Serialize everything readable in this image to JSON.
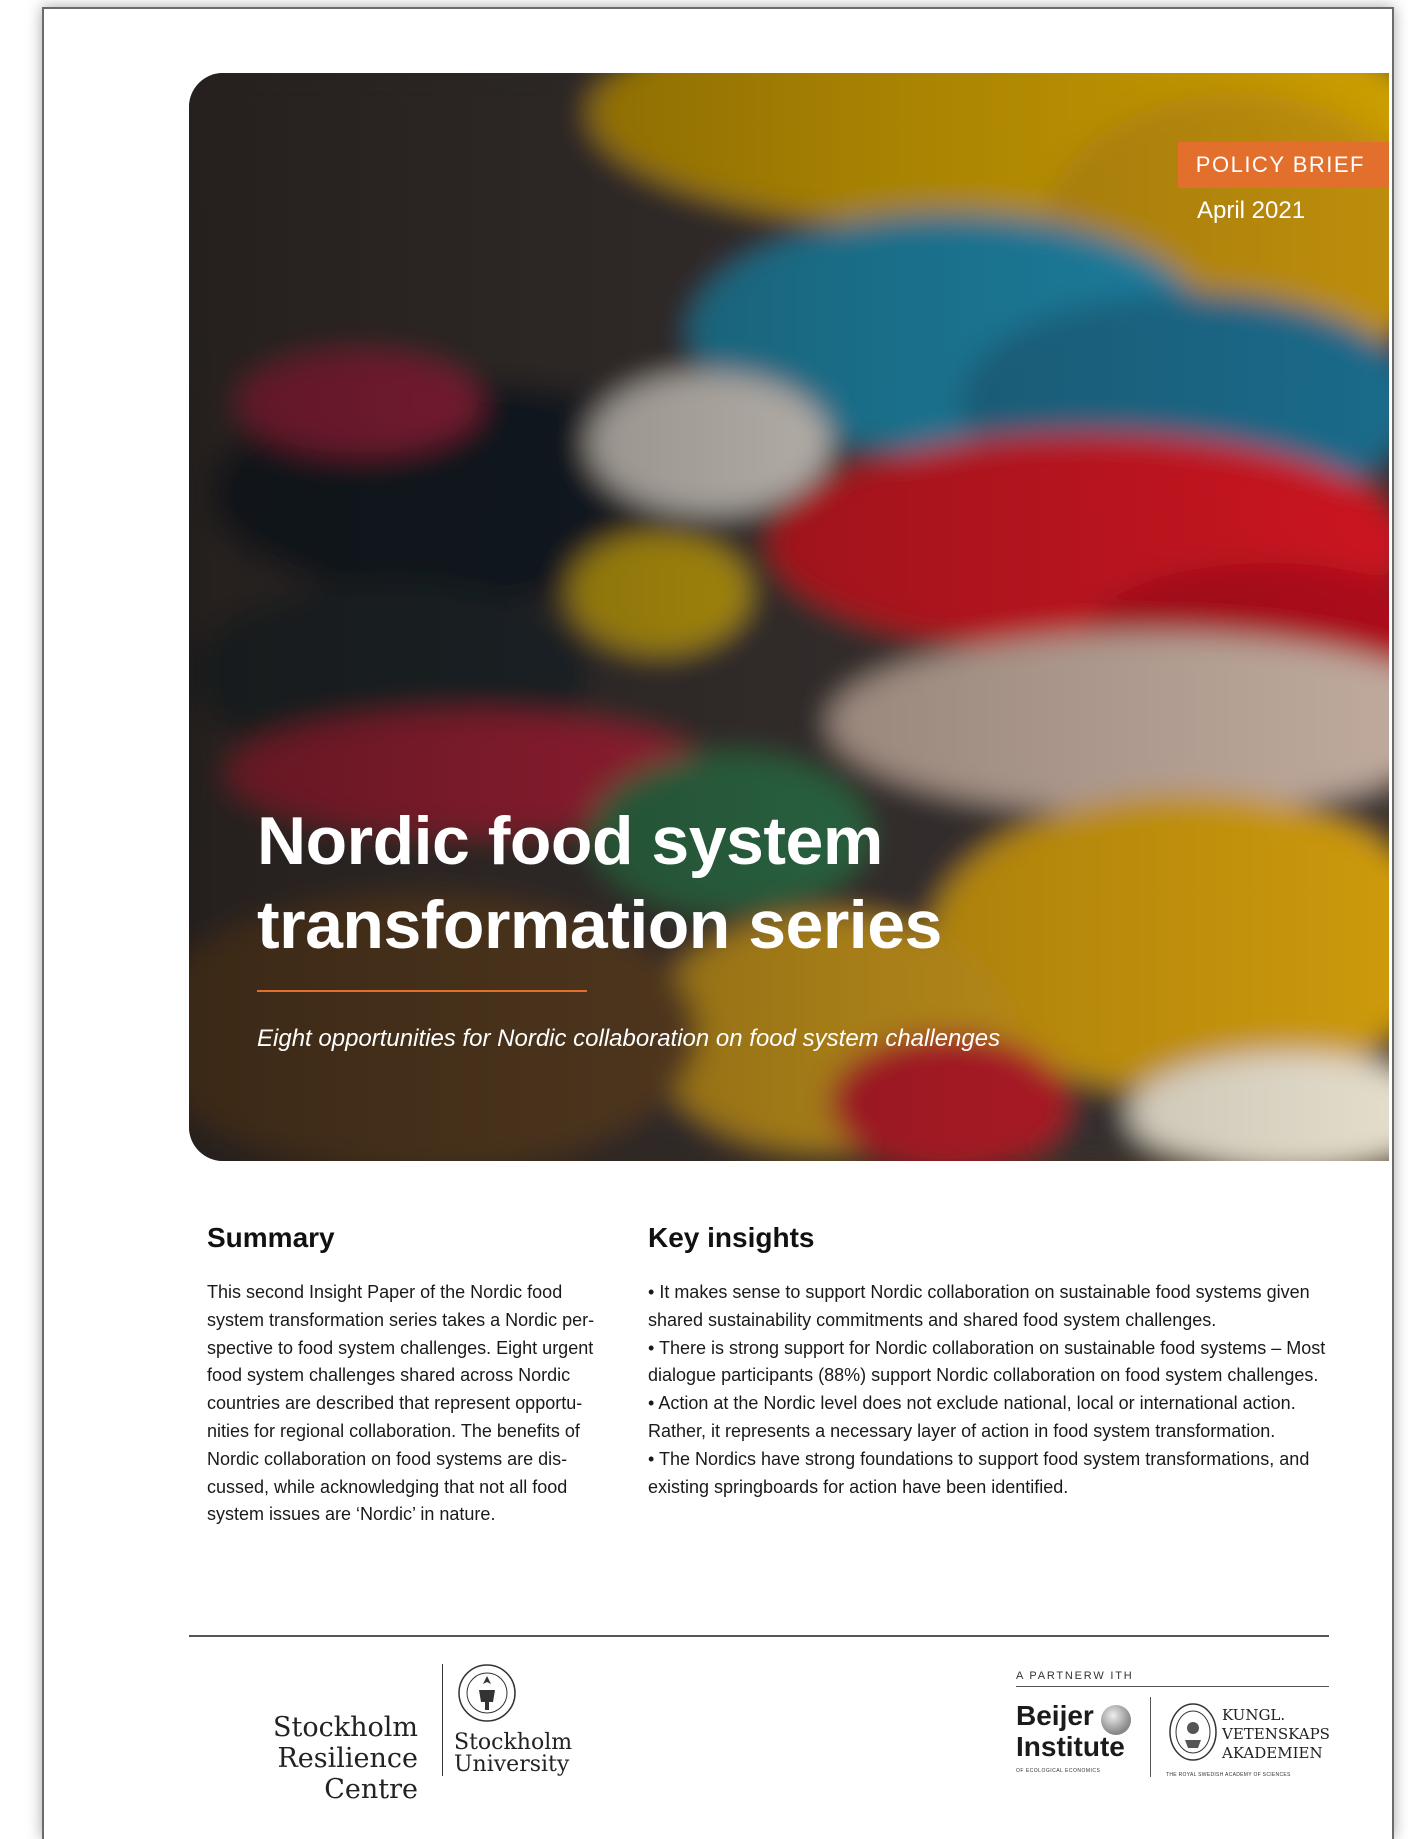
{
  "header": {
    "badge": "POLICY BRIEF",
    "date": "April 2021",
    "title_line1": "Nordic food system",
    "title_line2": "transformation series",
    "subtitle": "Eight opportunities for Nordic collaboration on food system challenges"
  },
  "summary": {
    "heading": "Summary",
    "text": "This second Insight Paper of the Nordic food system transformation series takes a Nordic per-spective to food system challenges. Eight urgent food system challenges shared across Nordic countries are described that represent opportu-nities for regional collaboration. The benefits of Nordic collaboration on food systems are dis-cussed, while acknowledging that not all food system issues are ‘Nordic’ in nature."
  },
  "insights": {
    "heading": "Key insights",
    "items": [
      "It makes sense to support Nordic collaboration on sustainable food systems given shared sustainability commitments and shared food system challenges.",
      "There is strong support for Nordic collaboration on sustainable food systems – Most dialogue participants (88%) support Nordic collaboration on food system challenges.",
      "Action at the Nordic level does not exclude national, local or international action. Rather, it represents a necessary layer of action in food system transformation.",
      "The Nordics have strong foundations to support food system transformations, and existing springboards for action have been identified."
    ]
  },
  "footer": {
    "src_line1": "Stockholm",
    "src_line2": "Resilience Centre",
    "su_line1": "Stockholm",
    "su_line2": "University",
    "partner_label": "A PARTNERW ITH",
    "beijer_line1": "Beijer",
    "beijer_line2": "Institute",
    "beijer_sub": "OF ECOLOGICAL ECONOMICS",
    "kva_line1": "KUNGL.",
    "kva_line2": "VETENSKAPS",
    "kva_line3": "AKADEMIEN",
    "kva_sub": "THE ROYAL SWEDISH ACADEMY OF SCIENCES"
  },
  "colors": {
    "accent": "#e36f2c",
    "text": "#1a1a1a"
  }
}
